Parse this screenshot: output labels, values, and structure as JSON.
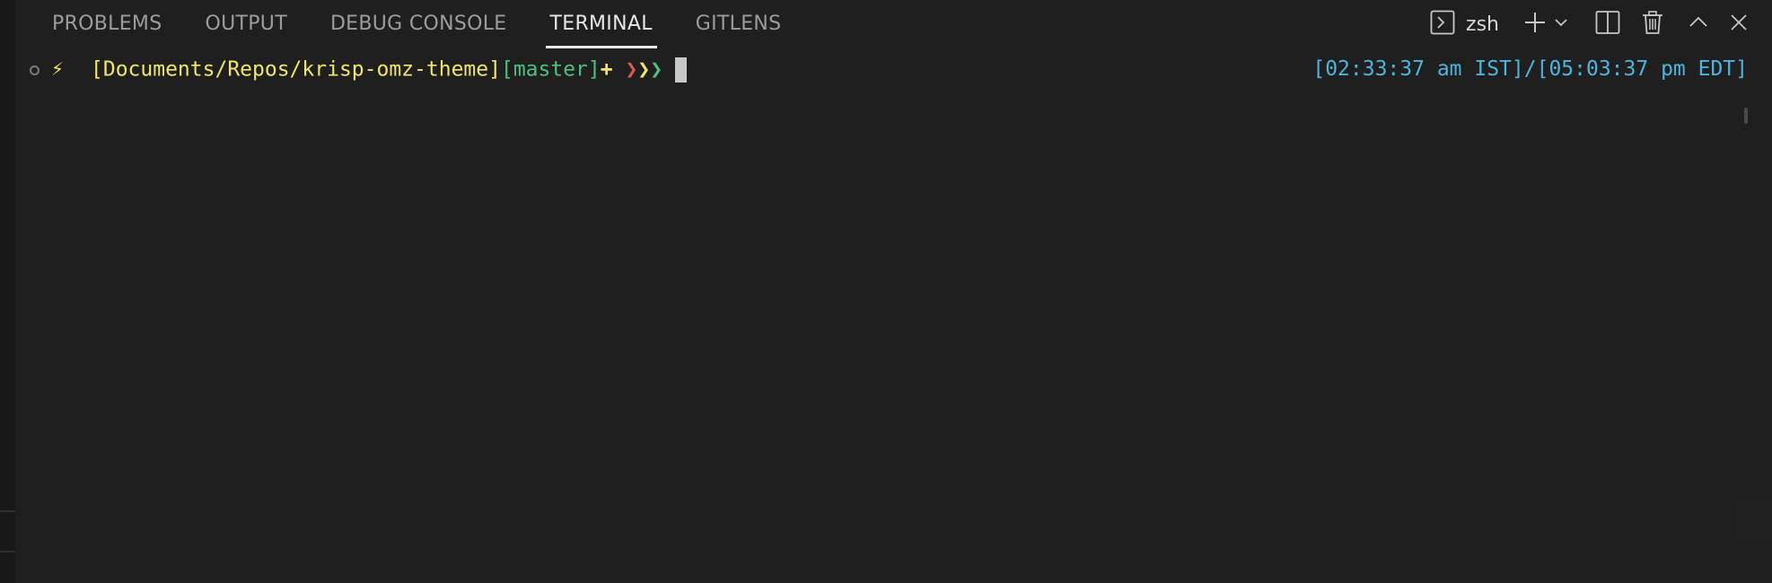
{
  "panel": {
    "tabs": [
      {
        "label": "PROBLEMS",
        "active": false
      },
      {
        "label": "OUTPUT",
        "active": false
      },
      {
        "label": "DEBUG CONSOLE",
        "active": false
      },
      {
        "label": "TERMINAL",
        "active": true
      },
      {
        "label": "GITLENS",
        "active": false
      }
    ],
    "toolbar": {
      "shell_label": "zsh",
      "icons": [
        "terminal-icon",
        "plus-icon",
        "chevron-down-icon",
        "split-icon",
        "trash-icon",
        "chevron-up-icon",
        "close-icon"
      ]
    }
  },
  "terminal": {
    "bolt": "⚡",
    "path": "[Documents/Repos/krisp-omz-theme]",
    "branch": "[master]",
    "dirty_marker": "+",
    "arrows": [
      "❯",
      "❯",
      "❯"
    ],
    "clock": "[02:33:37 am IST]/[05:03:37 pm EDT]"
  },
  "colors": {
    "background": "#1f1f1f",
    "path": "#f2e66a",
    "branch": "#4ec07f",
    "clock": "#4db4e0",
    "arrow_red": "#e05a4f",
    "arrow_yellow": "#f2e66a",
    "arrow_green": "#4ec07f"
  }
}
